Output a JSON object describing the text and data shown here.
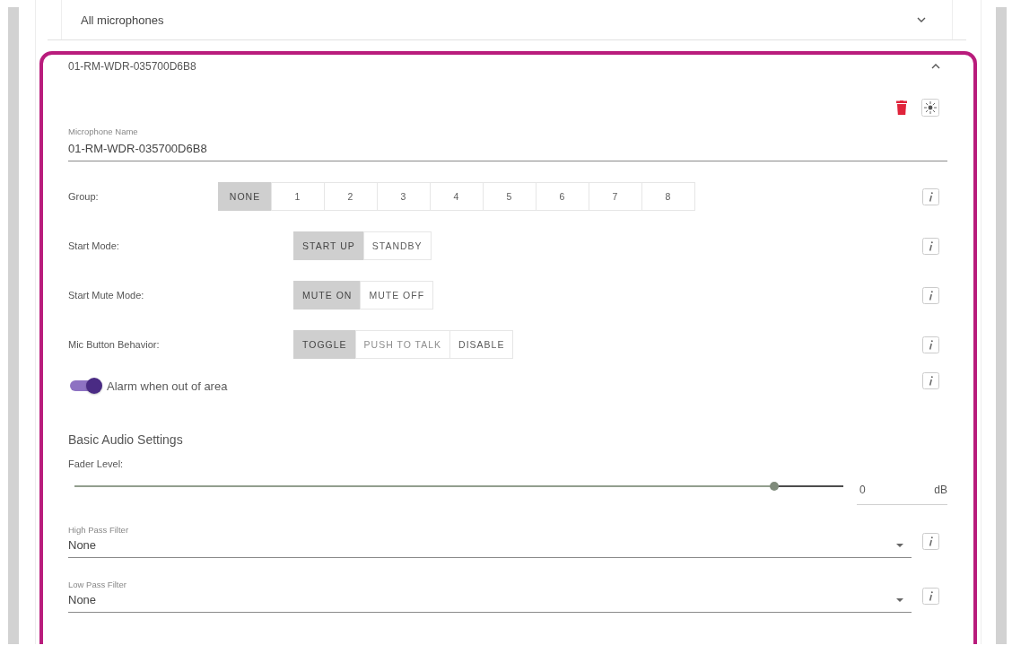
{
  "all_microphones": {
    "label": "All microphones",
    "expanded": false
  },
  "microphone": {
    "title": "01-RM-WDR-035700D6B8",
    "expanded": true,
    "name_field": {
      "label": "Microphone Name",
      "value": "01-RM-WDR-035700D6B8"
    },
    "settings": [
      {
        "kind": "group",
        "label": "Group:",
        "options": [
          {
            "label": "NONE",
            "selected": true,
            "disabled": false
          },
          {
            "label": "1",
            "selected": false,
            "disabled": false
          },
          {
            "label": "2",
            "selected": false,
            "disabled": false
          },
          {
            "label": "3",
            "selected": false,
            "disabled": false
          },
          {
            "label": "4",
            "selected": false,
            "disabled": false
          },
          {
            "label": "5",
            "selected": false,
            "disabled": false
          },
          {
            "label": "6",
            "selected": false,
            "disabled": false
          },
          {
            "label": "7",
            "selected": false,
            "disabled": false
          },
          {
            "label": "8",
            "selected": false,
            "disabled": false
          }
        ]
      },
      {
        "kind": "mode",
        "label": "Start Mode:",
        "options": [
          {
            "label": "START UP",
            "selected": true,
            "disabled": false
          },
          {
            "label": "STANDBY",
            "selected": false,
            "disabled": false
          }
        ]
      },
      {
        "kind": "mode",
        "label": "Start Mute Mode:",
        "options": [
          {
            "label": "MUTE ON",
            "selected": true,
            "disabled": false
          },
          {
            "label": "MUTE OFF",
            "selected": false,
            "disabled": false
          }
        ]
      },
      {
        "kind": "mode",
        "label": "Mic Button Behavior:",
        "options": [
          {
            "label": "TOGGLE",
            "selected": true,
            "disabled": false
          },
          {
            "label": "PUSH TO TALK",
            "selected": false,
            "disabled": true
          },
          {
            "label": "DISABLE",
            "selected": false,
            "disabled": false
          }
        ]
      }
    ],
    "alarm_toggle": {
      "label": "Alarm when out of area",
      "on": true
    },
    "audio": {
      "heading": "Basic Audio Settings",
      "fader": {
        "label": "Fader Level:",
        "level": 0.91,
        "value": "0",
        "unit": "dB"
      },
      "filters": [
        {
          "label": "High Pass Filter",
          "value": "None"
        },
        {
          "label": "Low Pass Filter",
          "value": "None"
        }
      ]
    }
  }
}
